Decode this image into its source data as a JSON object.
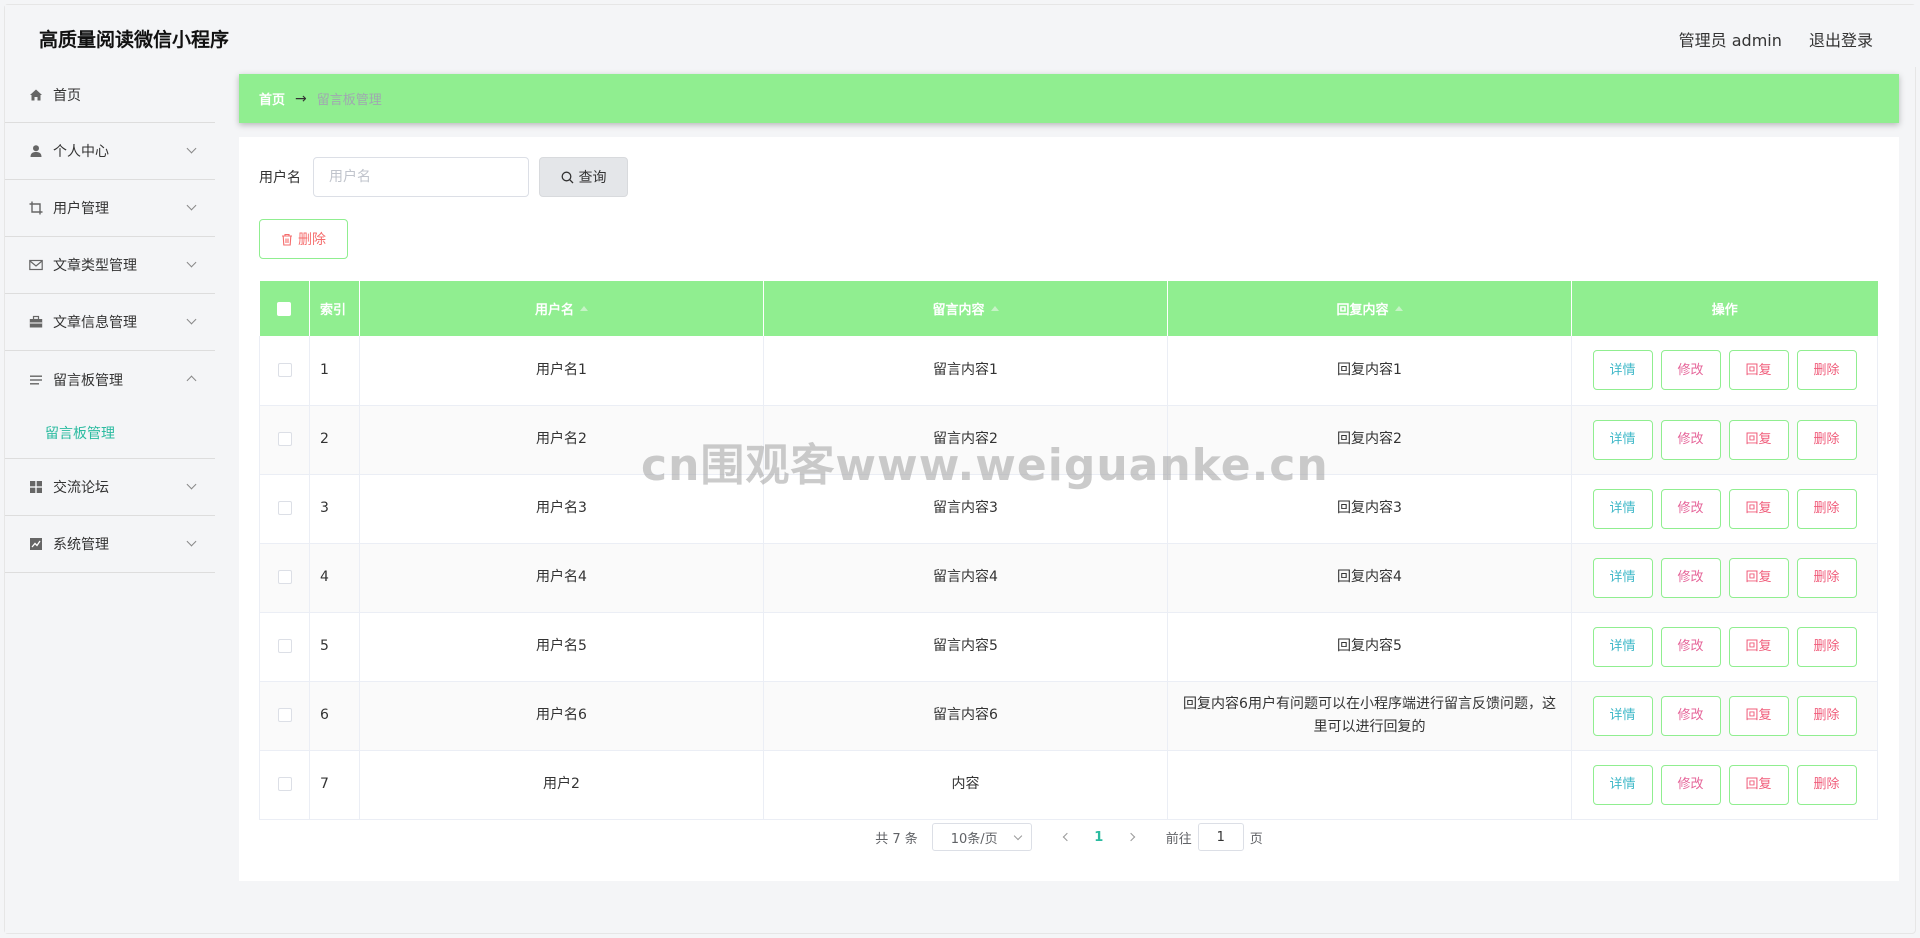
{
  "header": {
    "app_title": "高质量阅读微信小程序",
    "user_label": "管理员 admin",
    "logout_label": "退出登录"
  },
  "sidebar": {
    "items": [
      {
        "label": "首页",
        "icon": "home-icon"
      },
      {
        "label": "个人中心",
        "icon": "user-icon"
      },
      {
        "label": "用户管理",
        "icon": "crop-icon"
      },
      {
        "label": "文章类型管理",
        "icon": "mail-icon"
      },
      {
        "label": "文章信息管理",
        "icon": "briefcase-icon"
      },
      {
        "label": "留言板管理",
        "icon": "list-icon",
        "expanded": true,
        "sub": "留言板管理"
      },
      {
        "label": "交流论坛",
        "icon": "grid-icon"
      },
      {
        "label": "系统管理",
        "icon": "chart-icon"
      }
    ]
  },
  "breadcrumb": {
    "home": "首页",
    "separator": "→",
    "current": "留言板管理"
  },
  "search": {
    "label": "用户名",
    "placeholder": "用户名",
    "value": "",
    "button_label": "查询"
  },
  "toolbar": {
    "delete_label": "删除"
  },
  "table": {
    "headers": {
      "index": "索引",
      "username": "用户名",
      "message": "留言内容",
      "reply": "回复内容",
      "actions": "操作"
    },
    "rows": [
      {
        "index": "1",
        "username": "用户名1",
        "message": "留言内容1",
        "reply": "回复内容1"
      },
      {
        "index": "2",
        "username": "用户名2",
        "message": "留言内容2",
        "reply": "回复内容2"
      },
      {
        "index": "3",
        "username": "用户名3",
        "message": "留言内容3",
        "reply": "回复内容3"
      },
      {
        "index": "4",
        "username": "用户名4",
        "message": "留言内容4",
        "reply": "回复内容4"
      },
      {
        "index": "5",
        "username": "用户名5",
        "message": "留言内容5",
        "reply": "回复内容5"
      },
      {
        "index": "6",
        "username": "用户名6",
        "message": "留言内容6",
        "reply": "回复内容6用户有问题可以在小程序端进行留言反馈问题，这里可以进行回复的"
      },
      {
        "index": "7",
        "username": "用户2",
        "message": "内容",
        "reply": ""
      }
    ],
    "actions": {
      "detail": "详情",
      "edit": "修改",
      "reply": "回复",
      "delete": "删除"
    }
  },
  "pagination": {
    "total": "共 7 条",
    "page_size": "10条/页",
    "current_page": "1",
    "goto_prefix": "前往",
    "goto_value": "1",
    "goto_suffix": "页"
  },
  "watermark": "cn围观客www.weiguanke.cn",
  "colors": {
    "accent_green": "#90ee90",
    "active_teal": "#2bbba0",
    "danger": "#f56c6c"
  }
}
